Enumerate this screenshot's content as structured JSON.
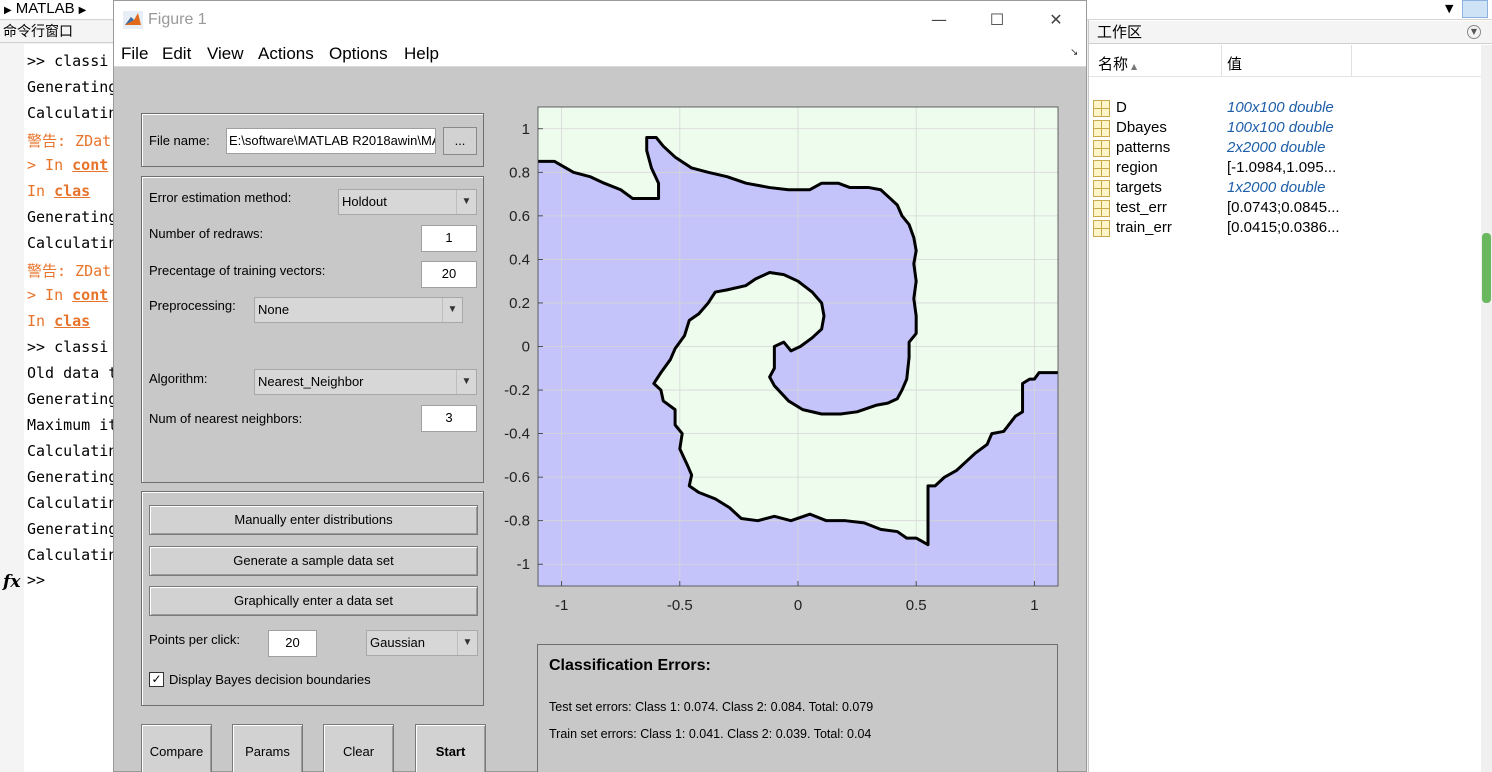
{
  "matlab": {
    "breadcrumb": "MATLAB",
    "command_window_title": "命令行窗口",
    "command_lines": [
      {
        "prompt": ">> ",
        "text": "classi",
        "kind": "normal"
      },
      {
        "prompt": "",
        "text": "Generating",
        "kind": "normal"
      },
      {
        "prompt": "",
        "text": "Calculatin",
        "kind": "normal"
      },
      {
        "prompt": "",
        "text": "警告: ZDat",
        "kind": "warn"
      },
      {
        "prompt": "> In ",
        "text": "cont",
        "kind": "link"
      },
      {
        "prompt": "  In ",
        "text": "clas",
        "kind": "link"
      },
      {
        "prompt": "",
        "text": "Generating",
        "kind": "normal"
      },
      {
        "prompt": "",
        "text": "Calculatin",
        "kind": "normal"
      },
      {
        "prompt": "",
        "text": "警告: ZDat",
        "kind": "warn"
      },
      {
        "prompt": "> In ",
        "text": "cont",
        "kind": "link"
      },
      {
        "prompt": "  In ",
        "text": "clas",
        "kind": "link"
      },
      {
        "prompt": ">>  ",
        "text": "classi",
        "kind": "normal"
      },
      {
        "prompt": "",
        "text": "Old data t",
        "kind": "normal"
      },
      {
        "prompt": "",
        "text": "Generating",
        "kind": "normal"
      },
      {
        "prompt": "",
        "text": "Maximum it",
        "kind": "normal"
      },
      {
        "prompt": "",
        "text": "Calculatin",
        "kind": "normal"
      },
      {
        "prompt": "",
        "text": "Generating",
        "kind": "normal"
      },
      {
        "prompt": "",
        "text": "Calculatin",
        "kind": "normal"
      },
      {
        "prompt": "",
        "text": "Generating",
        "kind": "normal"
      },
      {
        "prompt": "",
        "text": "Calculatin",
        "kind": "normal"
      }
    ],
    "fx_symbol": "fx",
    "final_prompt": ">>"
  },
  "workspace": {
    "title": "工作区",
    "col_name": "名称",
    "col_value": "值",
    "variables": [
      {
        "name": "D",
        "value": "100x100 double",
        "italic": true
      },
      {
        "name": "Dbayes",
        "value": "100x100 double",
        "italic": true
      },
      {
        "name": "patterns",
        "value": "2x2000 double",
        "italic": true
      },
      {
        "name": "region",
        "value": "[-1.0984,1.095...",
        "italic": false
      },
      {
        "name": "targets",
        "value": "1x2000 double",
        "italic": true
      },
      {
        "name": "test_err",
        "value": "[0.0743;0.0845...",
        "italic": false
      },
      {
        "name": "train_err",
        "value": "[0.0415;0.0386...",
        "italic": false
      }
    ]
  },
  "figure": {
    "title": "Figure 1",
    "win_minimize": "—",
    "win_maximize": "☐",
    "win_close": "✕",
    "menu": [
      "File",
      "Edit",
      "View",
      "Actions",
      "Options",
      "Help"
    ],
    "file_label": "File name:",
    "file_value": "E:\\software\\MATLAB R2018awin\\MA",
    "browse_label": "...",
    "error_method_label": "Error estimation method:",
    "error_method_value": "Holdout",
    "redraws_label": "Number of redraws:",
    "redraws_value": "1",
    "training_label": "Precentage of training vectors:",
    "training_value": "20",
    "preprocessing_label": "Preprocessing:",
    "preprocessing_value": "None",
    "algorithm_label": "Algorithm:",
    "algorithm_value": "Nearest_Neighbor",
    "neighbors_label": "Num of nearest neighbors:",
    "neighbors_value": "3",
    "btn_manual": "Manually enter distributions",
    "btn_generate": "Generate a sample data set",
    "btn_graphical": "Graphically enter a data set",
    "points_label": "Points per click:",
    "points_value": "20",
    "distribution_value": "Gaussian",
    "bayes_checkbox_label": "Display Bayes decision boundaries",
    "bayes_checked": true,
    "btn_compare": "Compare",
    "btn_params": "Params",
    "btn_clear": "Clear",
    "btn_start": "Start",
    "errors_title": "Classification Errors:",
    "test_errors": "Test set errors: Class 1: 0.074. Class 2: 0.084. Total: 0.079",
    "train_errors": "Train set errors: Class 1: 0.041. Class 2: 0.039. Total: 0.04"
  },
  "chart_data": {
    "type": "area",
    "title": "",
    "xlabel": "",
    "ylabel": "",
    "xlim": [
      -1.1,
      1.1
    ],
    "ylim": [
      -1.1,
      1.1
    ],
    "xticks": [
      -1,
      -0.5,
      0,
      0.5,
      1
    ],
    "xtick_labels": [
      "-1",
      "-0.5",
      "0",
      "0.5",
      "1"
    ],
    "yticks": [
      1,
      0.8,
      0.6,
      0.4,
      0.2,
      0,
      -0.2,
      -0.4,
      -0.6,
      -0.8,
      -1
    ],
    "ytick_labels": [
      "1",
      "0.8",
      "0.6",
      "0.4",
      "0.2",
      "0",
      "-0.2",
      "-0.4",
      "-0.6",
      "-0.8",
      "-1"
    ],
    "grid": true,
    "colors": {
      "class_a": "#c4c4fa",
      "class_b": "#eefcee",
      "boundary": "#000000"
    },
    "upper_region": [
      [
        -1.1,
        0.85
      ],
      [
        -1.03,
        0.85
      ],
      [
        -0.95,
        0.8
      ],
      [
        -0.88,
        0.78
      ],
      [
        -0.82,
        0.75
      ],
      [
        -0.75,
        0.72
      ],
      [
        -0.7,
        0.68
      ],
      [
        -0.67,
        0.68
      ],
      [
        -0.59,
        0.68
      ],
      [
        -0.59,
        0.75
      ],
      [
        -0.62,
        0.82
      ],
      [
        -0.64,
        0.9
      ],
      [
        -0.64,
        0.96
      ],
      [
        -0.6,
        0.96
      ],
      [
        -0.57,
        0.92
      ],
      [
        -0.52,
        0.87
      ],
      [
        -0.45,
        0.82
      ],
      [
        -0.38,
        0.8
      ],
      [
        -0.3,
        0.78
      ],
      [
        -0.22,
        0.75
      ],
      [
        -0.12,
        0.73
      ],
      [
        -0.04,
        0.72
      ],
      [
        0.05,
        0.72
      ],
      [
        0.1,
        0.75
      ],
      [
        0.17,
        0.75
      ],
      [
        0.22,
        0.73
      ],
      [
        0.3,
        0.73
      ],
      [
        0.35,
        0.72
      ],
      [
        0.39,
        0.68
      ],
      [
        0.42,
        0.65
      ],
      [
        0.44,
        0.6
      ],
      [
        0.47,
        0.56
      ],
      [
        0.49,
        0.5
      ],
      [
        0.5,
        0.44
      ],
      [
        0.49,
        0.38
      ],
      [
        0.5,
        0.3
      ],
      [
        0.49,
        0.22
      ],
      [
        0.5,
        0.14
      ],
      [
        0.5,
        0.06
      ],
      [
        0.47,
        0.02
      ],
      [
        0.47,
        -0.05
      ],
      [
        0.46,
        -0.15
      ],
      [
        0.44,
        -0.2
      ],
      [
        0.42,
        -0.24
      ],
      [
        0.38,
        -0.26
      ],
      [
        0.33,
        -0.27
      ],
      [
        0.25,
        -0.3
      ],
      [
        0.18,
        -0.31
      ],
      [
        0.1,
        -0.31
      ],
      [
        0.02,
        -0.29
      ],
      [
        -0.04,
        -0.25
      ],
      [
        -0.1,
        -0.18
      ],
      [
        -0.12,
        -0.14
      ],
      [
        -0.1,
        -0.1
      ],
      [
        -0.1,
        0.0
      ],
      [
        -0.06,
        0.02
      ],
      [
        -0.03,
        -0.02
      ],
      [
        0.01,
        0.0
      ],
      [
        0.06,
        0.04
      ],
      [
        0.1,
        0.08
      ],
      [
        0.11,
        0.14
      ],
      [
        0.1,
        0.2
      ],
      [
        0.06,
        0.25
      ],
      [
        0.0,
        0.3
      ],
      [
        -0.06,
        0.33
      ],
      [
        -0.12,
        0.34
      ],
      [
        -0.18,
        0.31
      ],
      [
        -0.22,
        0.28
      ],
      [
        -0.3,
        0.26
      ],
      [
        -0.35,
        0.25
      ],
      [
        -0.38,
        0.2
      ],
      [
        -0.42,
        0.15
      ],
      [
        -0.46,
        0.12
      ],
      [
        -0.48,
        0.05
      ],
      [
        -0.52,
        -0.01
      ],
      [
        -0.54,
        -0.06
      ],
      [
        -0.58,
        -0.12
      ],
      [
        -0.61,
        -0.17
      ],
      [
        -0.58,
        -0.2
      ],
      [
        -0.57,
        -0.25
      ],
      [
        -0.52,
        -0.29
      ],
      [
        -0.52,
        -0.36
      ],
      [
        -0.49,
        -0.4
      ],
      [
        -0.5,
        -0.47
      ],
      [
        -0.47,
        -0.54
      ],
      [
        -0.45,
        -0.59
      ],
      [
        -0.46,
        -0.64
      ],
      [
        -0.42,
        -0.67
      ],
      [
        -0.35,
        -0.7
      ],
      [
        -0.29,
        -0.74
      ],
      [
        -0.24,
        -0.79
      ],
      [
        -0.17,
        -0.8
      ],
      [
        -0.1,
        -0.78
      ],
      [
        -0.03,
        -0.8
      ],
      [
        0.05,
        -0.77
      ],
      [
        0.12,
        -0.8
      ],
      [
        0.2,
        -0.8
      ],
      [
        0.28,
        -0.81
      ],
      [
        0.35,
        -0.84
      ],
      [
        0.42,
        -0.85
      ],
      [
        0.46,
        -0.88
      ],
      [
        0.5,
        -0.88
      ],
      [
        0.55,
        -0.91
      ],
      [
        0.55,
        -0.7
      ],
      [
        0.55,
        -0.64
      ],
      [
        0.58,
        -0.64
      ],
      [
        0.62,
        -0.6
      ],
      [
        0.67,
        -0.57
      ],
      [
        0.75,
        -0.49
      ],
      [
        0.8,
        -0.45
      ],
      [
        0.82,
        -0.4
      ],
      [
        0.87,
        -0.39
      ],
      [
        0.92,
        -0.32
      ],
      [
        0.95,
        -0.3
      ],
      [
        0.95,
        -0.17
      ],
      [
        0.98,
        -0.15
      ],
      [
        1.0,
        -0.15
      ],
      [
        1.02,
        -0.12
      ],
      [
        1.1,
        -0.12
      ]
    ],
    "inner_boundary": [
      [
        -0.1,
        -0.1
      ],
      [
        -0.1,
        0.0
      ],
      [
        -0.06,
        0.02
      ],
      [
        -0.03,
        -0.02
      ]
    ]
  }
}
